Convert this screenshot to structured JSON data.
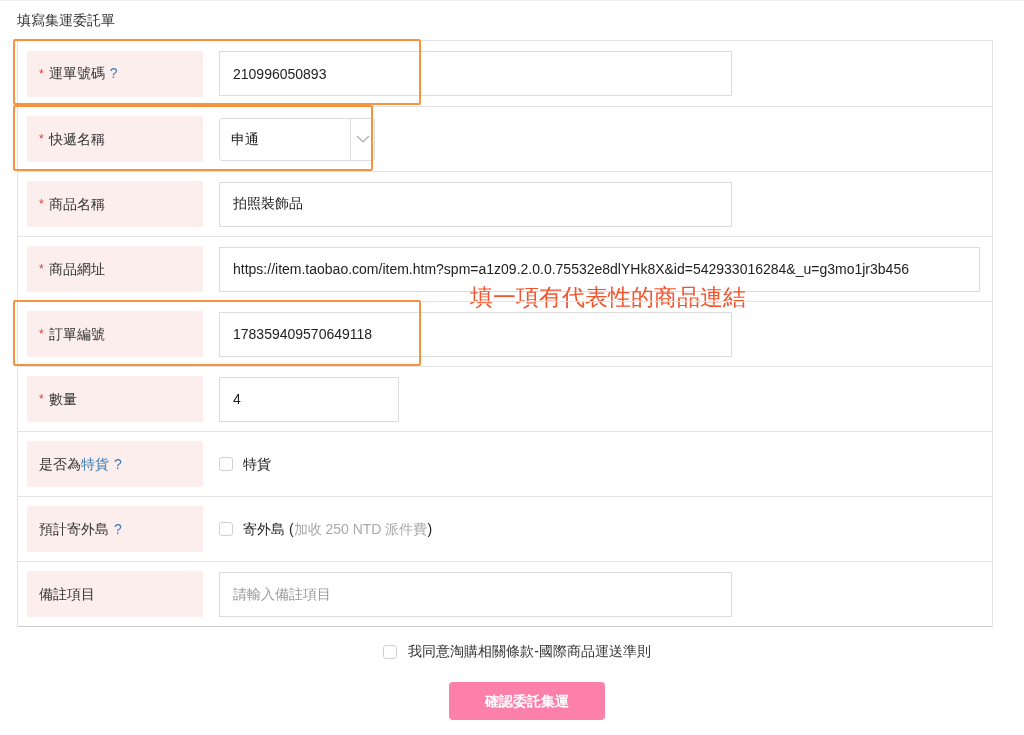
{
  "title": "填寫集運委託單",
  "rows": [
    {
      "required_mark": "*",
      "label": [
        {
          "text": "運單號碼",
          "kind": "plain"
        }
      ],
      "help": "?",
      "highlighted": true,
      "field": {
        "kind": "text",
        "value": "210996050893"
      }
    },
    {
      "required_mark": "*",
      "label": [
        {
          "text": "快遞名稱",
          "kind": "plain"
        }
      ],
      "highlighted": true,
      "field": {
        "kind": "select",
        "value": "申通"
      }
    },
    {
      "required_mark": "*",
      "label": [
        {
          "text": "商品名稱",
          "kind": "plain"
        }
      ],
      "highlighted": false,
      "field": {
        "kind": "text",
        "value": "拍照裝飾品"
      }
    },
    {
      "required_mark": "*",
      "label": [
        {
          "text": "商品網址",
          "kind": "plain"
        }
      ],
      "highlighted": false,
      "field": {
        "kind": "url",
        "value": "https://item.taobao.com/item.htm?spm=a1z09.2.0.0.75532e8dlYHk8X&id=542933016284&_u=g3mo1jr3b456"
      },
      "annotation": "填一項有代表性的商品連結"
    },
    {
      "required_mark": "*",
      "label": [
        {
          "text": "訂單編號",
          "kind": "plain"
        }
      ],
      "highlighted": true,
      "field": {
        "kind": "text",
        "value": "178359409570649118"
      }
    },
    {
      "required_mark": "*",
      "label": [
        {
          "text": "數量",
          "kind": "plain"
        }
      ],
      "highlighted": false,
      "field": {
        "kind": "number",
        "value": "4"
      }
    },
    {
      "label": [
        {
          "text": "是否為",
          "kind": "plain"
        },
        {
          "text": "特貨",
          "kind": "link"
        }
      ],
      "help": "?",
      "highlighted": false,
      "field": {
        "kind": "checkbox",
        "checked": false,
        "segments": [
          {
            "text": "特貨",
            "muted": false
          }
        ]
      }
    },
    {
      "label": [
        {
          "text": "預計寄外島",
          "kind": "plain"
        }
      ],
      "help": "?",
      "highlighted": false,
      "field": {
        "kind": "checkbox",
        "checked": false,
        "segments": [
          {
            "text": "寄外島 (",
            "muted": false
          },
          {
            "text": "加收 250 NTD 派件費",
            "muted": true
          },
          {
            "text": ")",
            "muted": false
          }
        ]
      }
    },
    {
      "label": [
        {
          "text": "備註項目",
          "kind": "plain"
        }
      ],
      "highlighted": false,
      "field": {
        "kind": "text",
        "placeholder": "請輸入備註項目"
      }
    }
  ],
  "agreement": {
    "checked": false,
    "text": "我同意淘購相關條款-國際商品運送準則"
  },
  "submit": "確認委託集運"
}
